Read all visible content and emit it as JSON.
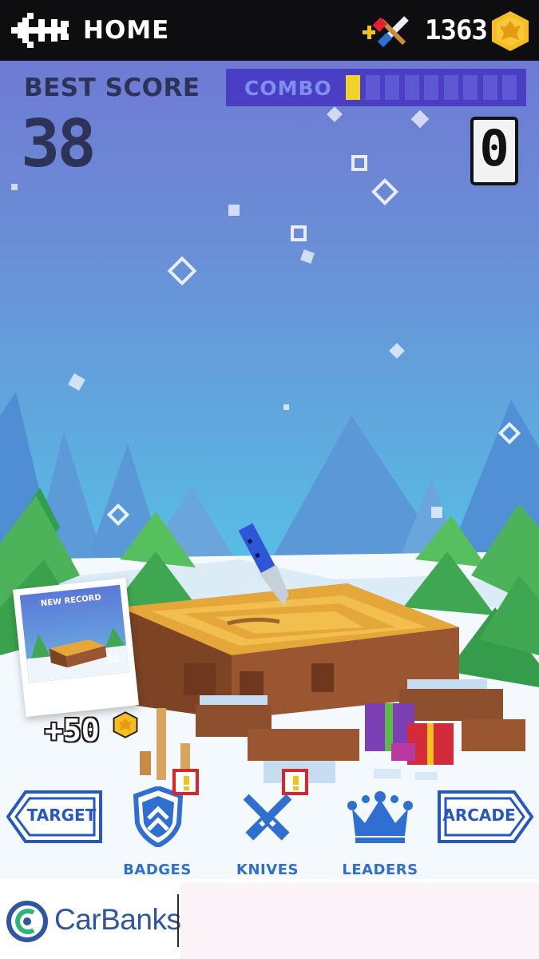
{
  "topbar": {
    "home_label": "HOME",
    "coin_count": "1363",
    "home_icon": "back-arrow-icon",
    "weapons_icon": "crossed-knife-axe-icon",
    "coin_icon": "gold-coin-icon"
  },
  "hud": {
    "best_score_label": "BEST SCORE",
    "best_score_value": "38",
    "combo_label": "COMBO",
    "combo_filled": 1,
    "combo_total": 9,
    "current_score": "0"
  },
  "reward": {
    "photo_title": "NEW RECORD",
    "photo_score": "38",
    "bonus": "+50"
  },
  "nav": {
    "target_label": "TARGET",
    "arcade_label": "ARCADE",
    "badges_label": "BADGES",
    "knives_label": "KNIVES",
    "leaders_label": "LEADERS"
  },
  "ad": {
    "brand": "CarBanks"
  },
  "colors": {
    "accent_blue": "#2f6fd1",
    "combo_bg": "#4a3fc4",
    "combo_fill": "#f2d32b",
    "alert_red": "#e3212b",
    "coin_gold": "#f5bd1f"
  }
}
